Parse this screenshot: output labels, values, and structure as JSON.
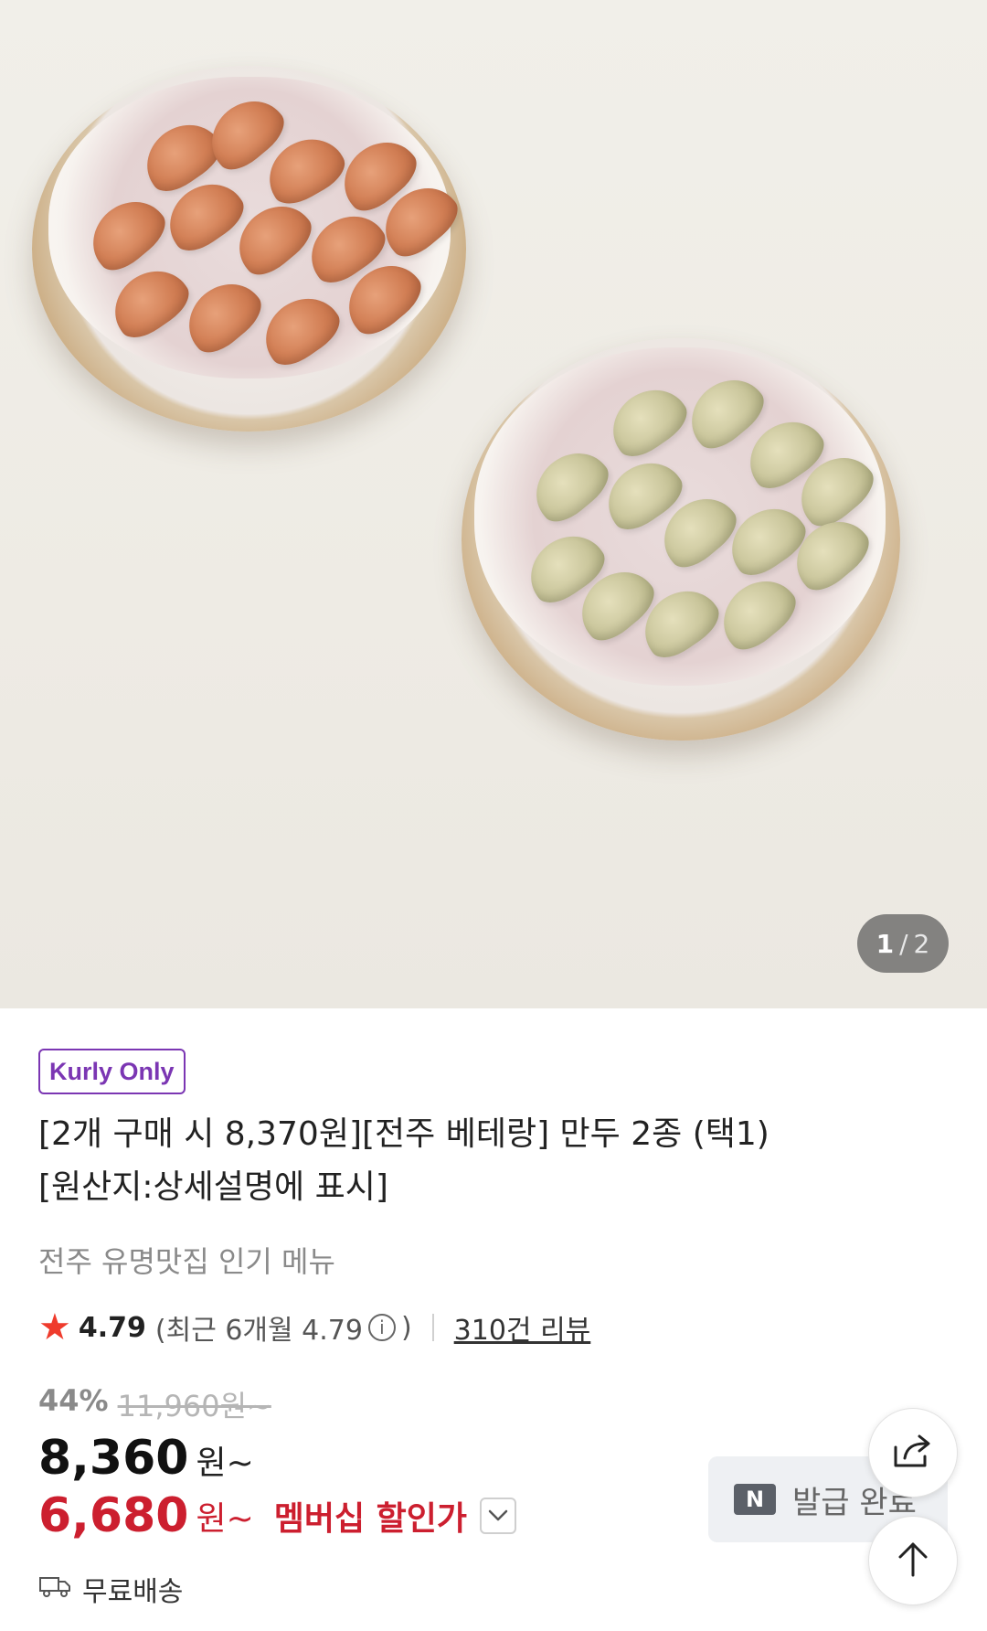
{
  "hero": {
    "counter_current": "1",
    "counter_separator": "/",
    "counter_total": "2"
  },
  "product": {
    "badge": "Kurly Only",
    "title_line1": "[2개 구매 시 8,370원][전주 베테랑] 만두 2종 (택1)",
    "title_line2": "[원산지:상세설명에 표시]",
    "subtitle": "전주 유명맛집 인기 메뉴"
  },
  "rating": {
    "score": "4.79",
    "recent_prefix": "(최근 6개월 4.79",
    "recent_suffix": ")",
    "info_icon_text": "i",
    "reviews": "310건 리뷰"
  },
  "price": {
    "discount_rate": "44%",
    "original": "11,960원~",
    "sale_amount": "8,360",
    "sale_unit": "원~",
    "member_amount": "6,680",
    "member_unit": "원~",
    "member_label": "멤버십 할인가"
  },
  "shipping": {
    "label": "무료배송"
  },
  "coupon": {
    "icon_text": "N",
    "label": "발급 완료"
  },
  "icons": {
    "star": "star-icon",
    "info": "info-icon",
    "chevron": "chevron-down-icon",
    "truck": "truck-icon",
    "share": "share-icon",
    "arrow_up": "arrow-up-icon"
  },
  "colors": {
    "brand_purple": "#7b36b3",
    "member_red": "#cc1f2f",
    "star_red": "#ef3b2c"
  }
}
